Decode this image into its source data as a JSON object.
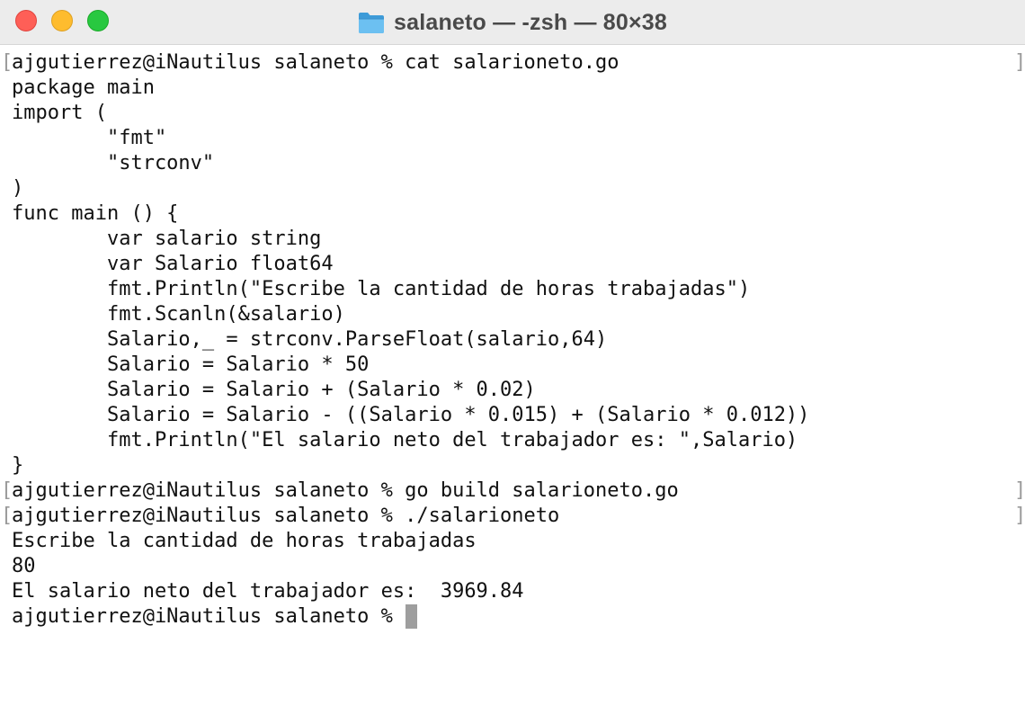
{
  "window": {
    "title": "salaneto — -zsh — 80×38",
    "title_icon": "folder-icon",
    "traffic_lights": {
      "close": "#fe5f57",
      "minimize": "#febc2e",
      "zoom": "#28c840"
    }
  },
  "terminal": {
    "prompt": "ajgutierrez@iNautilus salaneto %",
    "commands": {
      "cat": "cat salarioneto.go",
      "build": "go build salarioneto.go",
      "run": "./salarioneto"
    },
    "code_lines": [
      "package main",
      "import (",
      "        \"fmt\"",
      "        \"strconv\"",
      ")",
      "func main () {",
      "        var salario string",
      "        var Salario float64",
      "        fmt.Println(\"Escribe la cantidad de horas trabajadas\")",
      "        fmt.Scanln(&salario)",
      "        Salario,_ = strconv.ParseFloat(salario,64)",
      "        Salario = Salario * 50",
      "        Salario = Salario + (Salario * 0.02)",
      "        Salario = Salario - ((Salario * 0.015) + (Salario * 0.012))",
      "        fmt.Println(\"El salario neto del trabajador es: \",Salario)",
      "}"
    ],
    "output_lines": [
      "Escribe la cantidad de horas trabajadas",
      "80",
      "El salario neto del trabajador es:  3969.84"
    ],
    "bracket_left": "[",
    "bracket_right": "]"
  }
}
